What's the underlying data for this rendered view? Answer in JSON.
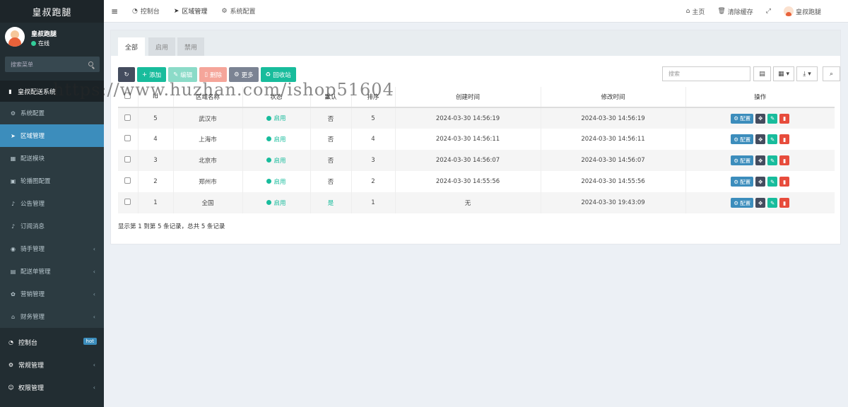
{
  "sidebar": {
    "logo": "皇叔跑腿",
    "user": {
      "name": "皇叔跑腿",
      "status": "在线"
    },
    "search_placeholder": "搜索菜单",
    "group_title": "皇叔配送系统",
    "items": [
      {
        "label": "系统配置",
        "icon": "gears-icon",
        "active": false,
        "chevron": false
      },
      {
        "label": "区域管理",
        "icon": "location-arrow-icon",
        "active": true,
        "chevron": false
      },
      {
        "label": "配送模块",
        "icon": "grid-icon",
        "active": false,
        "chevron": false
      },
      {
        "label": "轮播图配置",
        "icon": "image-icon",
        "active": false,
        "chevron": false
      },
      {
        "label": "公告管理",
        "icon": "bell-icon",
        "active": false,
        "chevron": false
      },
      {
        "label": "订阅消息",
        "icon": "bell-icon",
        "active": false,
        "chevron": false
      },
      {
        "label": "骑手管理",
        "icon": "user-circle-icon",
        "active": false,
        "chevron": true
      },
      {
        "label": "配送单管理",
        "icon": "list-icon",
        "active": false,
        "chevron": true
      },
      {
        "label": "营销管理",
        "icon": "gift-icon",
        "active": false,
        "chevron": true
      },
      {
        "label": "财务管理",
        "icon": "bank-icon",
        "active": false,
        "chevron": true
      }
    ],
    "top_items": [
      {
        "label": "控制台",
        "icon": "dashboard-icon",
        "badge": "hot"
      },
      {
        "label": "常规管理",
        "icon": "gears-icon",
        "chevron": true
      },
      {
        "label": "权限管理",
        "icon": "users-icon",
        "chevron": true
      }
    ]
  },
  "topbar": {
    "tabs": [
      {
        "label": "控制台",
        "icon": "dashboard-icon"
      },
      {
        "label": "区域管理",
        "icon": "location-arrow-icon"
      },
      {
        "label": "系统配置",
        "icon": "gears-icon"
      }
    ],
    "home": "主页",
    "clear_cache": "清除缓存",
    "username": "皇叔跑腿"
  },
  "filter_tabs": [
    "全部",
    "启用",
    "禁用"
  ],
  "toolbar": {
    "add": "添加",
    "edit": "编辑",
    "delete": "删除",
    "more": "更多",
    "recycle": "回收站",
    "search_placeholder": "搜索"
  },
  "table": {
    "headers": [
      "Id",
      "区域名称",
      "状态",
      "默认",
      "排序",
      "创建时间",
      "修改时间",
      "操作"
    ],
    "rows": [
      {
        "id": "5",
        "name": "武汉市",
        "status": "启用",
        "default": "否",
        "sort": "5",
        "created": "2024-03-30 14:56:19",
        "updated": "2024-03-30 14:56:19"
      },
      {
        "id": "4",
        "name": "上海市",
        "status": "启用",
        "default": "否",
        "sort": "4",
        "created": "2024-03-30 14:56:11",
        "updated": "2024-03-30 14:56:11"
      },
      {
        "id": "3",
        "name": "北京市",
        "status": "启用",
        "default": "否",
        "sort": "3",
        "created": "2024-03-30 14:56:07",
        "updated": "2024-03-30 14:56:07"
      },
      {
        "id": "2",
        "name": "郑州市",
        "status": "启用",
        "default": "否",
        "sort": "2",
        "created": "2024-03-30 14:55:56",
        "updated": "2024-03-30 14:55:56"
      },
      {
        "id": "1",
        "name": "全国",
        "status": "启用",
        "default": "是",
        "sort": "1",
        "created": "无",
        "updated": "2024-03-30 19:43:09"
      }
    ],
    "op_config_label": "配置"
  },
  "pagination_info": "显示第 1 到第 5 条记录，总共 5 条记录",
  "watermark": "https://www.huzhan.com/ishop51604",
  "colors": {
    "accent": "#3c8dbc",
    "success": "#18bc9c",
    "danger": "#e74c3c",
    "sidebar_bg": "#222d32"
  }
}
